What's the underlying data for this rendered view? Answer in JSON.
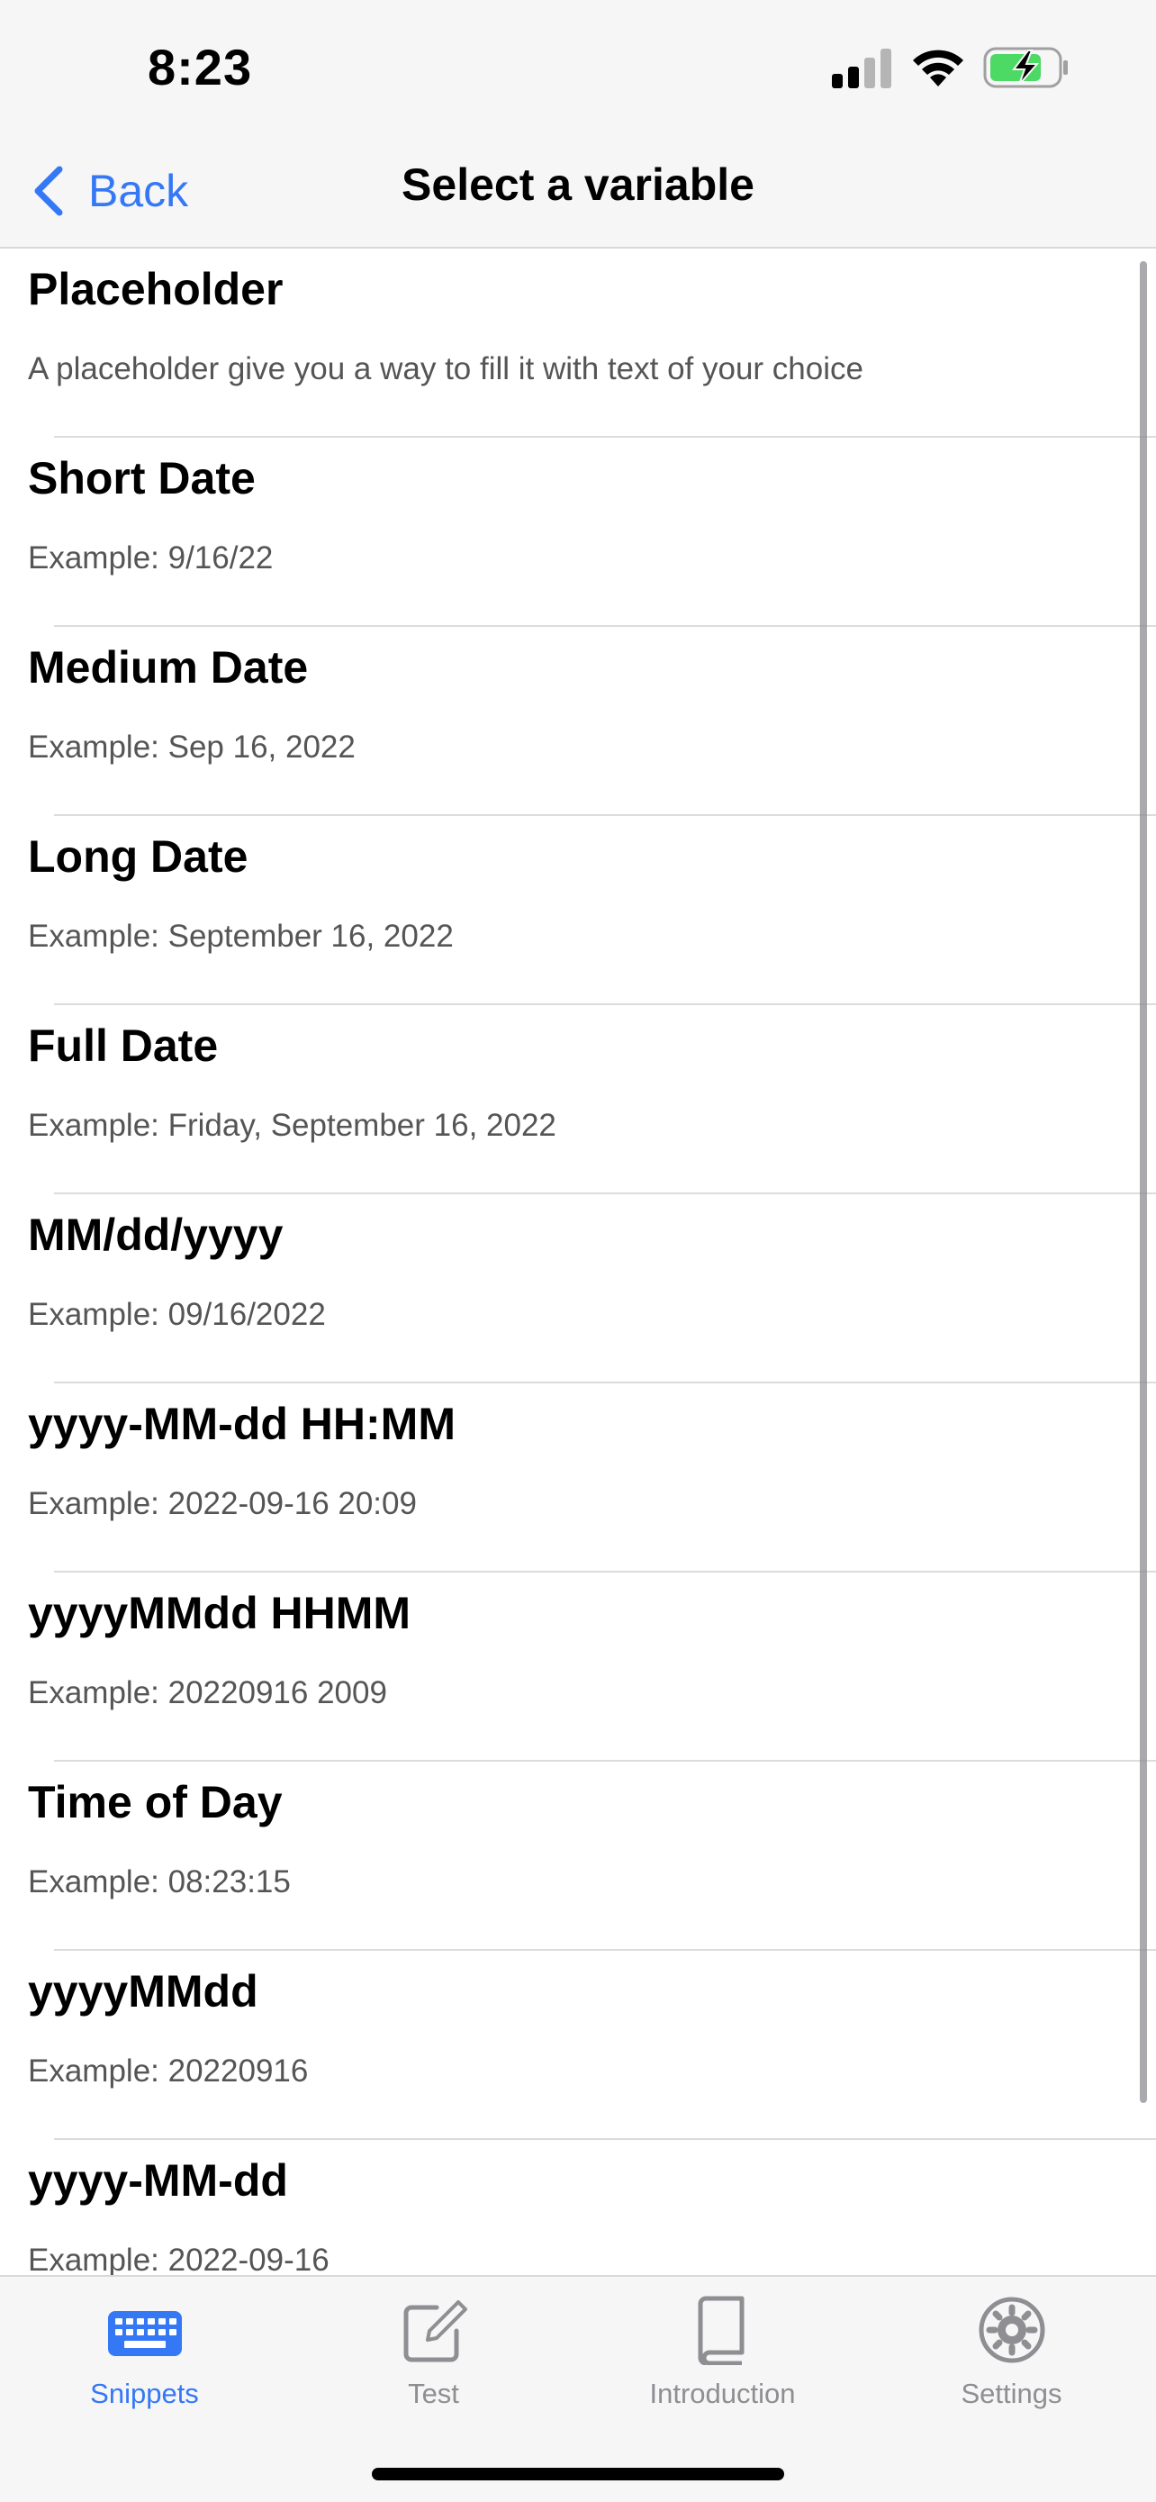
{
  "status_bar": {
    "time": "8:23"
  },
  "nav": {
    "back_label": "Back",
    "title": "Select a variable"
  },
  "variables": [
    {
      "title": "Placeholder",
      "subtitle": "A placeholder give you a way to fill it with text of your choice"
    },
    {
      "title": "Short Date",
      "subtitle": "Example: 9/16/22"
    },
    {
      "title": "Medium Date",
      "subtitle": "Example: Sep 16, 2022"
    },
    {
      "title": "Long Date",
      "subtitle": "Example: September 16, 2022"
    },
    {
      "title": "Full Date",
      "subtitle": "Example: Friday, September 16, 2022"
    },
    {
      "title": "MM/dd/yyyy",
      "subtitle": "Example: 09/16/2022"
    },
    {
      "title": "yyyy-MM-dd HH:MM",
      "subtitle": "Example: 2022-09-16 20:09"
    },
    {
      "title": "yyyyMMdd HHMM",
      "subtitle": "Example: 20220916 2009"
    },
    {
      "title": "Time of Day",
      "subtitle": "Example: 08:23:15"
    },
    {
      "title": "yyyyMMdd",
      "subtitle": "Example: 20220916"
    },
    {
      "title": "yyyy-MM-dd",
      "subtitle": "Example: 2022-09-16"
    }
  ],
  "tab_bar": {
    "tabs": [
      {
        "label": "Snippets",
        "icon": "keyboard-icon",
        "active": true
      },
      {
        "label": "Test",
        "icon": "compose-icon",
        "active": false
      },
      {
        "label": "Introduction",
        "icon": "book-icon",
        "active": false
      },
      {
        "label": "Settings",
        "icon": "gear-icon",
        "active": false
      }
    ]
  },
  "colors": {
    "accent": "#3478f6",
    "inactive": "#8e8e93",
    "battery_fill": "#4cd964"
  }
}
